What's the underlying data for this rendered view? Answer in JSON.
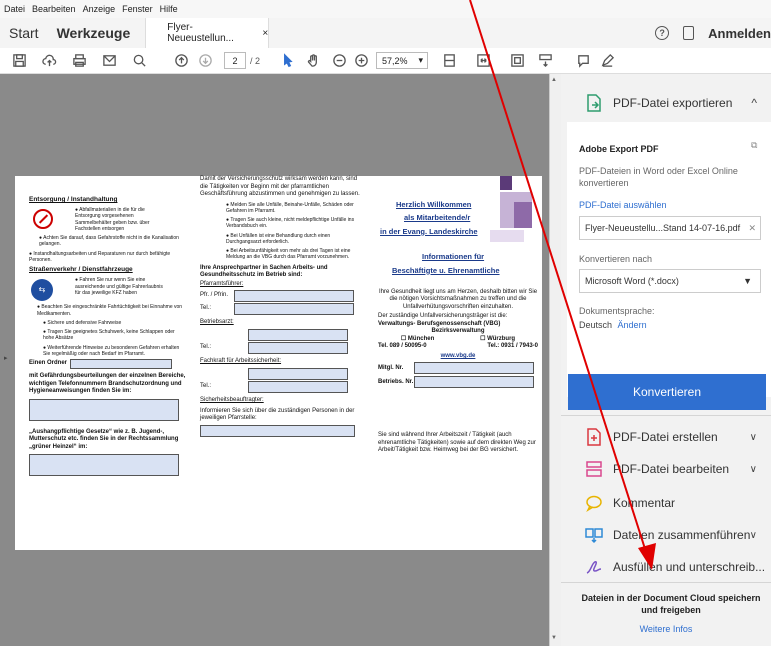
{
  "menubar": {
    "items": [
      "Datei",
      "Bearbeiten",
      "Anzeige",
      "Fenster",
      "Hilfe"
    ]
  },
  "tabs": {
    "start": "Start",
    "tools": "Werkzeuge",
    "doc": "Flyer-Neueustellun...",
    "close": "×",
    "help": "?",
    "signin": "Anmelden"
  },
  "toolbar": {
    "page": "2",
    "pages": "/ 2",
    "zoom": "57,2%"
  },
  "pdf": {
    "c1": {
      "h1": "Entsorgung / Instandhaltung",
      "b1": "● Abfallmaterialien in die für die Entsorgung vorgesehenen Sammelbehälter geben bzw. über Fachstellen entsorgen",
      "b2": "● Achten Sie darauf, dass Gefahrstoffe nicht in die Kanalisation gelangen.",
      "b3": "● Instandhaltungsarbeiten und Reparaturen nur durch befähigte Personen.",
      "h2": "Straßenverkehr / Dienstfahrzeuge",
      "b4": "● Fahren Sie nur wenn Sie eine ausreichende und gültige Fahrerlaubnis für das jeweilige KFZ haben",
      "b5": "● Beachten Sie eingeschränkte Fahrtüchtigkeit bei Einnahme von Medikamenten.",
      "b6": "● Sichere und defensive Fahrweise",
      "b7": "● Tragen Sie geeignetes Schuhwerk, keine Schlappen oder hohe Absätze",
      "b8": "● Weiterführende Hinweise zu besonderen Gefahren erhalten Sie regelmäßig oder nach Bedarf im Pfarramt.",
      "ordner": "Einen Ordner",
      "ordner2": "mit Gefährdungsbeurteilungen der einzelnen Bereiche, wichtigen Telefonnummern Brandschutzordnung und Hygieneanweisungen finden Sie im:",
      "aushang": "„Aushangpflichtige Gesetze“ wie z. B. Jugend-, Mutterschutz etc. finden Sie in der Rechtssammlung „grüner Heinzel“ im:"
    },
    "c2": {
      "p1": "Damit der Versicherungsschutz wirksam werden kann, sind die Tätigkeiten vor Beginn mit der pfarramtlichen Geschäftsführung abzustimmen und genehmigen zu lassen.",
      "b1": "● Melden Sie alle Unfälle, Beinahe-Unfälle, Schäden oder Gefahren im Pfarramt.",
      "b2": "● Tragen Sie auch kleine, nicht meldepflichtige Unfälle ins Verbandsbuch ein.",
      "b3": "● Bei Unfällen ist eine Behandlung durch einen Durchgangsarzt erforderlich.",
      "b4": "● Bei Arbeitsunfähigkeit von mehr als drei Tagen ist eine Meldung an die VBG durch das Pfarramt vorzunehmen.",
      "h1": "Ihre Ansprechpartner in Sachen Arbeits- und Gesundheitsschutz im Betrieb sind:",
      "pf": "Pfarramtsführer:",
      "pfr": "Pfr. / Pfrin.",
      "tel": "Tel.:",
      "ba": "Betriebsarzt:",
      "fa": "Fachkraft für Arbeitssicherheit:",
      "sb": "Sicherheitsbeauftragter:",
      "sb2": "Informieren Sie sich über die zuständigen Personen in der jeweiligen Pfarrstelle:"
    },
    "c3": {
      "w1": "Herzlich Willkommen",
      "w2": "als Mitarbeitende/r",
      "w3": "in der Evang. Landeskirche",
      "i1": "Informationen für",
      "i2": "Beschäftigte u. Ehrenamtliche",
      "p1": "Ihre Gesundheit liegt uns am Herzen, deshalb bitten wir Sie die nötigen Vorsichtsmaßnahmen zu treffen und die Unfallverhütungsvorschriften einzuhalten.",
      "p2": "Der zuständige Unfallversicherungsträger ist die:",
      "vbg": "Verwaltungs- Berufsgenossenschaft (VBG)",
      "bv": "Bezirksverwaltung",
      "m": "☐ München",
      "w": "☐ Würzburg",
      "tm": "Tel. 089 / 50095-0",
      "tw": "Tel.: 0931 / 7943-0",
      "web": "www.vbg.de",
      "mn": "Mitgl. Nr.",
      "bn": "Betriebs. Nr.",
      "p3": "Sie sind während Ihrer Arbeitszeit / Tätigkeit (auch ehrenamtliche Tätigkeiten) sowie auf dem direkten Weg zur Arbeit/Tätigkeit bzw. Heimweg bei der BG versichert."
    }
  },
  "panel": {
    "export_title": "PDF-Datei exportieren",
    "adobe_export": "Adobe Export PDF",
    "desc": "PDF-Dateien in Word oder Excel Online konvertieren",
    "choose": "PDF-Datei auswählen",
    "file": "Flyer-Neueustellu...Stand 14-07-16.pdf",
    "convert_to": "Konvertieren nach",
    "format": "Microsoft Word (*.docx)",
    "lang_label": "Dokumentsprache:",
    "lang": "Deutsch",
    "change": "Ändern",
    "convert_btn": "Konvertieren",
    "tools": [
      {
        "label": "PDF-Datei erstellen"
      },
      {
        "label": "PDF-Datei bearbeiten"
      },
      {
        "label": "Kommentar"
      },
      {
        "label": "Dateien zusammenführen"
      },
      {
        "label": "Ausfüllen und unterschreib..."
      }
    ],
    "cloud": "Dateien in der Document Cloud speichern und freigeben",
    "more": "Weitere Infos"
  },
  "colors": {
    "accent": "#2f6fd0",
    "arrow": "#e00000"
  }
}
